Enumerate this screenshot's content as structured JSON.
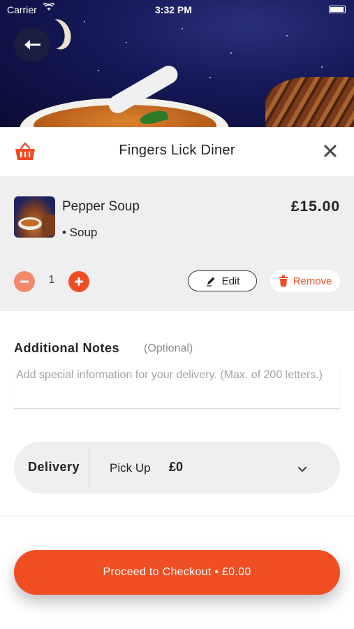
{
  "status_bar": {
    "carrier": "Carrier",
    "time": "3:32 PM"
  },
  "header": {
    "title": "Fingers Lick Diner",
    "icons": {
      "back": "arrow-left-icon",
      "basket": "basket-icon",
      "close": "close-icon"
    }
  },
  "cart_item": {
    "name": "Pepper Soup",
    "subtitle": "• Soup",
    "price": "£15.00",
    "quantity": "1",
    "edit_label": "Edit",
    "remove_label": "Remove"
  },
  "notes": {
    "title": "Additional Notes",
    "optional_label": "(Optional)",
    "placeholder": "Add special information for your delivery. (Max. of 200 letters.)",
    "value": ""
  },
  "delivery": {
    "label": "Delivery",
    "selected_option": "Pick Up",
    "fee": "£0"
  },
  "checkout": {
    "label": "Proceed to Checkout • £0.00"
  },
  "colors": {
    "accent": "#f04e23",
    "accent_light": "#f08a6b",
    "panel_bg": "#efefef"
  }
}
